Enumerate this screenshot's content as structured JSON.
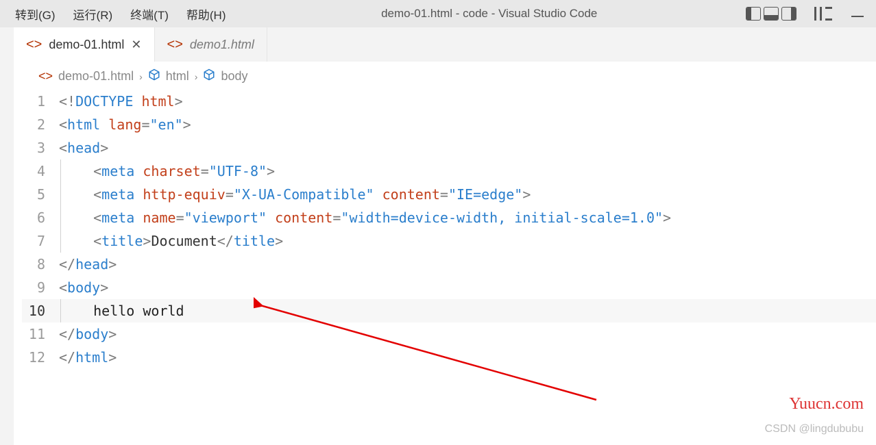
{
  "menu": {
    "go": "转到(G)",
    "run": "运行(R)",
    "terminal": "终端(T)",
    "help": "帮助(H)"
  },
  "window_title": "demo-01.html - code - Visual Studio Code",
  "tabs": [
    {
      "label": "demo-01.html",
      "active": true
    },
    {
      "label": "demo1.html",
      "active": false
    }
  ],
  "breadcrumb": {
    "file": "demo-01.html",
    "seg1": "html",
    "seg2": "body"
  },
  "code_lines": [
    {
      "n": "1",
      "html": "<span class='tk-gray'>&lt;!</span><span class='tk-tag'>DOCTYPE</span> <span class='tk-attr'>html</span><span class='tk-gray'>&gt;</span>"
    },
    {
      "n": "2",
      "html": "<span class='tk-gray'>&lt;</span><span class='tk-tag'>html</span> <span class='tk-attr'>lang</span><span class='tk-gray'>=</span><span class='tk-str'>\"en\"</span><span class='tk-gray'>&gt;</span>"
    },
    {
      "n": "3",
      "html": "<span class='tk-gray'>&lt;</span><span class='tk-tag'>head</span><span class='tk-gray'>&gt;</span>"
    },
    {
      "n": "4",
      "html": "<span class='indent-guide'></span>   <span class='tk-gray'>&lt;</span><span class='tk-tag'>meta</span> <span class='tk-attr'>charset</span><span class='tk-gray'>=</span><span class='tk-str'>\"UTF-8\"</span><span class='tk-gray'>&gt;</span>"
    },
    {
      "n": "5",
      "html": "<span class='indent-guide'></span>   <span class='tk-gray'>&lt;</span><span class='tk-tag'>meta</span> <span class='tk-attr'>http-equiv</span><span class='tk-gray'>=</span><span class='tk-str'>\"X-UA-Compatible\"</span> <span class='tk-attr'>content</span><span class='tk-gray'>=</span><span class='tk-str'>\"IE=edge\"</span><span class='tk-gray'>&gt;</span>"
    },
    {
      "n": "6",
      "html": "<span class='indent-guide'></span>   <span class='tk-gray'>&lt;</span><span class='tk-tag'>meta</span> <span class='tk-attr'>name</span><span class='tk-gray'>=</span><span class='tk-str'>\"viewport\"</span> <span class='tk-attr'>content</span><span class='tk-gray'>=</span><span class='tk-str'>\"width=device-width, initial-scale=1.0\"</span><span class='tk-gray'>&gt;</span>"
    },
    {
      "n": "7",
      "html": "<span class='indent-guide'></span>   <span class='tk-gray'>&lt;</span><span class='tk-tag'>title</span><span class='tk-gray'>&gt;</span><span class='tk-title-text'>Document</span><span class='tk-gray'>&lt;/</span><span class='tk-tag'>title</span><span class='tk-gray'>&gt;</span>"
    },
    {
      "n": "8",
      "html": "<span class='tk-gray'>&lt;/</span><span class='tk-tag'>head</span><span class='tk-gray'>&gt;</span>"
    },
    {
      "n": "9",
      "html": "<span class='tk-gray'>&lt;</span><span class='tk-tag'>body</span><span class='tk-gray'>&gt;</span>"
    },
    {
      "n": "10",
      "html": "<span class='indent-guide'></span>   <span class='tk-text'>hello world</span>",
      "active": true
    },
    {
      "n": "11",
      "html": "<span class='tk-gray'>&lt;/</span><span class='tk-tag'>body</span><span class='tk-gray'>&gt;</span>"
    },
    {
      "n": "12",
      "html": "<span class='tk-gray'>&lt;/</span><span class='tk-tag'>html</span><span class='tk-gray'>&gt;</span>"
    }
  ],
  "watermark1": "Yuucn.com",
  "watermark2": "CSDN @lingdububu"
}
